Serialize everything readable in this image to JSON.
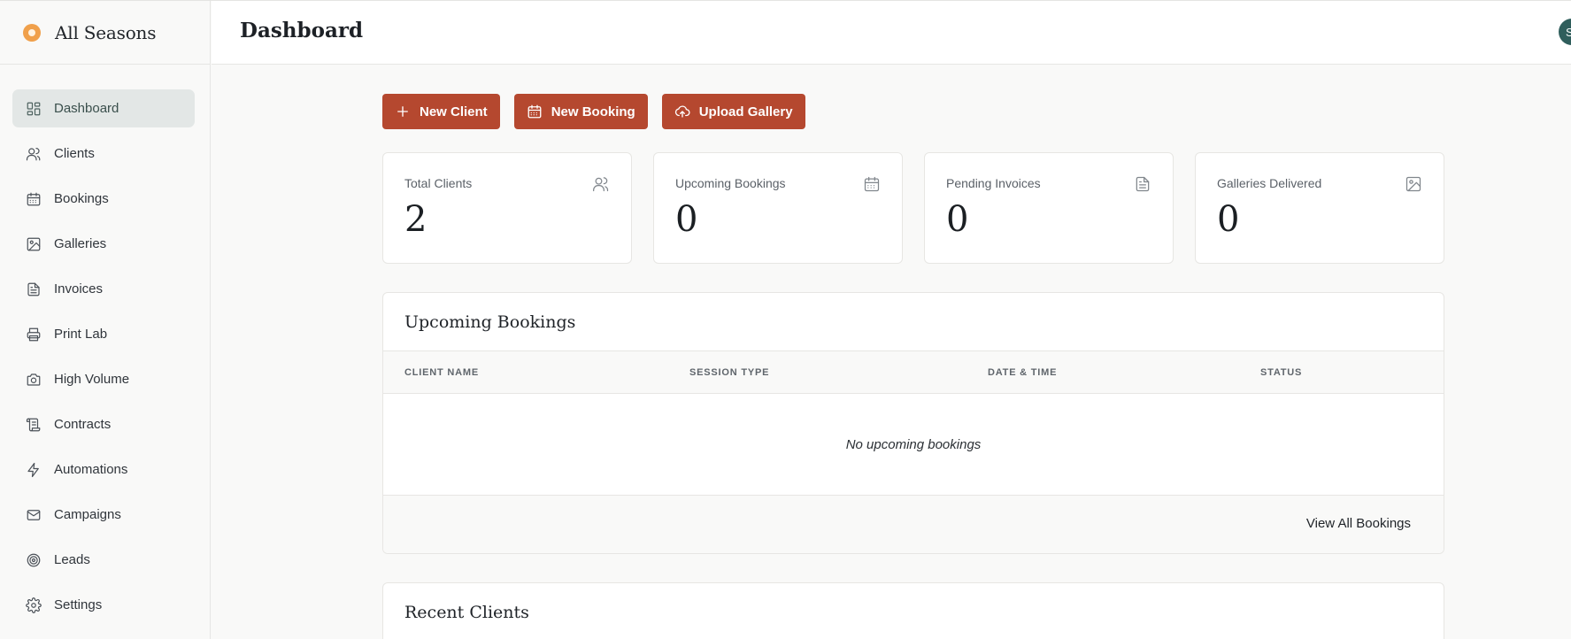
{
  "brand": {
    "name": "All Seasons",
    "logo_color": "#f0a04b"
  },
  "header": {
    "title": "Dashboard",
    "avatar_initial": "S"
  },
  "sidebar": {
    "items": [
      {
        "label": "Dashboard",
        "icon": "dashboard-icon",
        "active": true
      },
      {
        "label": "Clients",
        "icon": "users-icon"
      },
      {
        "label": "Bookings",
        "icon": "calendar-icon"
      },
      {
        "label": "Galleries",
        "icon": "image-icon"
      },
      {
        "label": "Invoices",
        "icon": "document-icon"
      },
      {
        "label": "Print Lab",
        "icon": "printer-icon"
      },
      {
        "label": "High Volume",
        "icon": "camera-icon"
      },
      {
        "label": "Contracts",
        "icon": "scroll-icon"
      },
      {
        "label": "Automations",
        "icon": "bolt-icon"
      },
      {
        "label": "Campaigns",
        "icon": "mail-icon"
      },
      {
        "label": "Leads",
        "icon": "target-icon"
      },
      {
        "label": "Settings",
        "icon": "gear-icon"
      }
    ]
  },
  "actions": {
    "new_client": "New Client",
    "new_booking": "New Booking",
    "upload_gallery": "Upload Gallery",
    "accent": "#b5482f"
  },
  "stats": [
    {
      "label": "Total Clients",
      "value": "2",
      "icon": "users-icon"
    },
    {
      "label": "Upcoming Bookings",
      "value": "0",
      "icon": "calendar-icon"
    },
    {
      "label": "Pending Invoices",
      "value": "0",
      "icon": "document-icon"
    },
    {
      "label": "Galleries Delivered",
      "value": "0",
      "icon": "image-icon"
    }
  ],
  "upcoming": {
    "title": "Upcoming Bookings",
    "columns": [
      "CLIENT NAME",
      "SESSION TYPE",
      "DATE & TIME",
      "STATUS"
    ],
    "empty_text": "No upcoming bookings",
    "view_all": "View All Bookings"
  },
  "recent_clients": {
    "title": "Recent Clients"
  }
}
